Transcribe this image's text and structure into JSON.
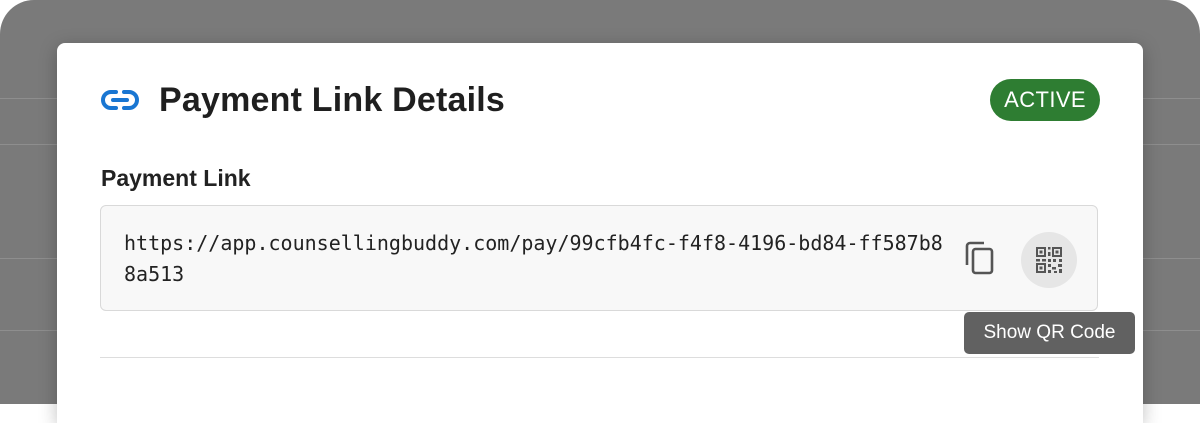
{
  "modal": {
    "title": "Payment Link Details",
    "title_icon": "link-icon",
    "status_badge": "ACTIVE",
    "section_label": "Payment Link",
    "payment_url": "https://app.counsellingbuddy.com/pay/99cfb4fc-f4f8-4196-bd84-ff587b88a513",
    "actions": {
      "copy_icon": "copy-icon",
      "qr_icon": "qr-code-icon"
    },
    "tooltip": "Show QR Code"
  },
  "colors": {
    "accent": "#1976d2",
    "badge_active": "#2e7d32",
    "tooltip_bg": "#616161",
    "overlay": "#7a7a7a"
  }
}
